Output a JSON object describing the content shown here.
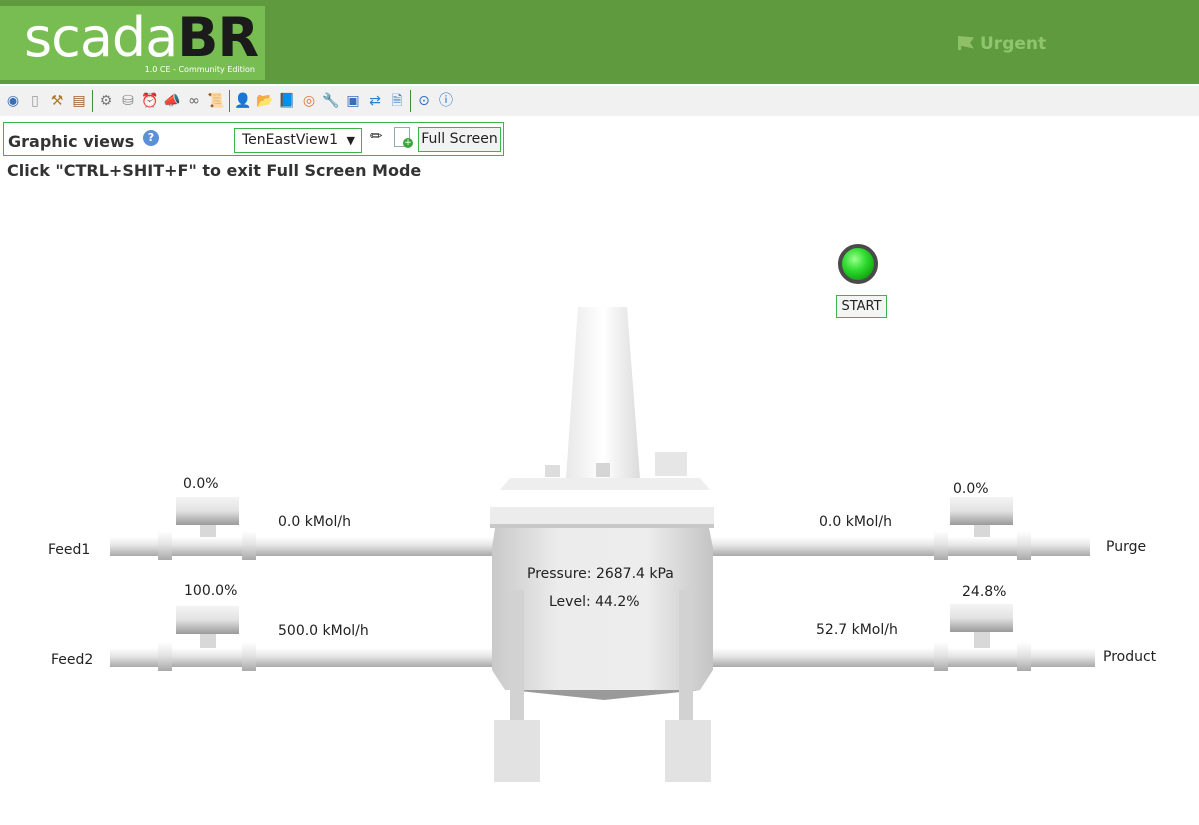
{
  "header": {
    "logo_part1": "scada",
    "logo_part2": "BR",
    "logo_subtitle": "1.0 CE - Community Edition",
    "urgent_label": "Urgent",
    "colors": {
      "header_bg": "#5f9a3f",
      "logo_bg": "#78bd52"
    }
  },
  "toolbar": {
    "icons": [
      "eye-icon",
      "page-icon",
      "hammer-icon",
      "list-icon",
      "gear-icon",
      "database-icon",
      "alarm-clock-icon",
      "megaphone-icon",
      "link-icon",
      "scroll-icon",
      "user-icon",
      "folder-icon",
      "book-icon",
      "broadcast-icon",
      "wrench-icon",
      "window-icon",
      "sync-icon",
      "document-icon",
      "record-icon",
      "help-icon"
    ]
  },
  "view_bar": {
    "title": "Graphic views",
    "selected_view": "TenEastView1",
    "fullscreen_label": "Full Screen",
    "hint": "Click \"CTRL+SHIT+F\" to exit Full Screen Mode"
  },
  "process": {
    "start_label": "START",
    "feed1_label": "Feed1",
    "feed2_label": "Feed2",
    "purge_label": "Purge",
    "product_label": "Product",
    "feed1_valve": "0.0%",
    "feed2_valve": "100.0%",
    "purge_valve": "0.0%",
    "product_valve": "24.8%",
    "feed1_flow": "0.0 kMol/h",
    "feed2_flow": "500.0 kMol/h",
    "purge_flow": "0.0 kMol/h",
    "product_flow": "52.7 kMol/h",
    "pressure": "Pressure: 2687.4 kPa",
    "level": "Level: 44.2%",
    "start_led_color": "#2fdc2f"
  }
}
